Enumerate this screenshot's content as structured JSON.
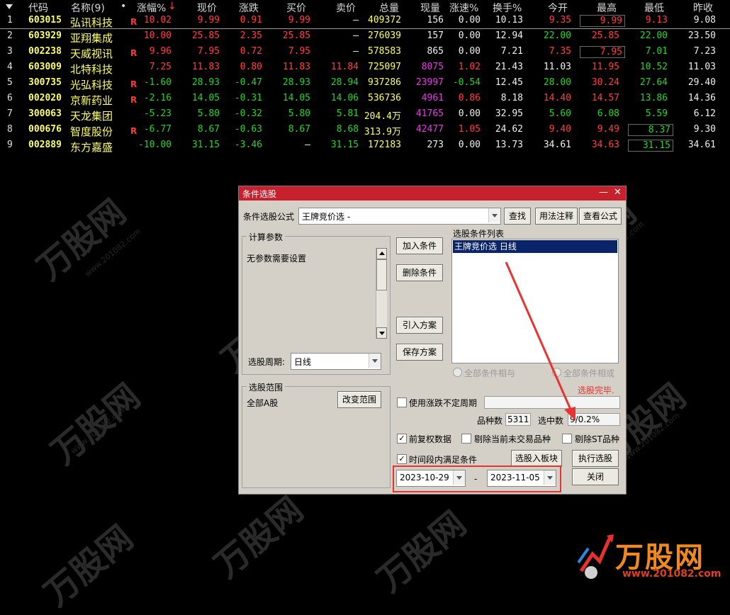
{
  "table": {
    "headers": [
      "代码",
      "名称(9)",
      "•",
      "涨幅%",
      "现价",
      "涨跌",
      "买价",
      "卖价",
      "总量",
      "现量",
      "涨速%",
      "换手%",
      "今开",
      "最高",
      "最低",
      "昨收"
    ],
    "sort_arrow": "↓",
    "rows": [
      {
        "idx": "1",
        "code": "603015",
        "name": "弘讯科技",
        "r": "R",
        "pct": "10.02",
        "price": "9.99",
        "chg": "0.91",
        "bid": "9.99",
        "ask": "–",
        "vol": "409372",
        "cur": "156",
        "speed": "0.00",
        "turn": "10.13",
        "open": "9.35",
        "high": "9.99",
        "low": "9.13",
        "prev": "9.08"
      },
      {
        "idx": "2",
        "code": "603929",
        "name": "亚翔集成",
        "r": "",
        "pct": "10.00",
        "price": "25.85",
        "chg": "2.35",
        "bid": "25.85",
        "ask": "–",
        "vol": "276039",
        "cur": "157",
        "speed": "0.00",
        "turn": "12.94",
        "open": "22.00",
        "high": "25.85",
        "low": "22.00",
        "prev": "23.50"
      },
      {
        "idx": "3",
        "code": "002238",
        "name": "天威视讯",
        "r": "R",
        "pct": "9.96",
        "price": "7.95",
        "chg": "0.72",
        "bid": "7.95",
        "ask": "–",
        "vol": "578583",
        "cur": "865",
        "speed": "0.00",
        "turn": "7.21",
        "open": "7.35",
        "high": "7.95",
        "low": "7.01",
        "prev": "7.23"
      },
      {
        "idx": "4",
        "code": "603009",
        "name": "北特科技",
        "r": "",
        "pct": "7.25",
        "price": "11.83",
        "chg": "0.80",
        "bid": "11.83",
        "ask": "11.84",
        "vol": "725097",
        "cur": "8075",
        "speed": "1.02",
        "turn": "21.43",
        "open": "11.03",
        "high": "11.95",
        "low": "10.52",
        "prev": "11.03"
      },
      {
        "idx": "5",
        "code": "300735",
        "name": "光弘科技",
        "r": "R",
        "pct": "-1.60",
        "price": "28.93",
        "chg": "-0.47",
        "bid": "28.93",
        "ask": "28.94",
        "vol": "937286",
        "cur": "23997",
        "speed": "-0.54",
        "turn": "12.45",
        "open": "28.00",
        "high": "30.24",
        "low": "27.64",
        "prev": "29.40"
      },
      {
        "idx": "6",
        "code": "002020",
        "name": "京新药业",
        "r": "R",
        "pct": "-2.16",
        "price": "14.05",
        "chg": "-0.31",
        "bid": "14.05",
        "ask": "14.06",
        "vol": "536736",
        "cur": "4961",
        "speed": "0.86",
        "turn": "8.18",
        "open": "14.40",
        "high": "14.57",
        "low": "13.86",
        "prev": "14.36"
      },
      {
        "idx": "7",
        "code": "300063",
        "name": "天龙集团",
        "r": "",
        "pct": "-5.23",
        "price": "5.80",
        "chg": "-0.32",
        "bid": "5.80",
        "ask": "5.81",
        "vol": "204.4万",
        "cur": "41765",
        "speed": "0.00",
        "turn": "32.95",
        "open": "5.60",
        "high": "6.08",
        "low": "5.59",
        "prev": "6.12"
      },
      {
        "idx": "8",
        "code": "000676",
        "name": "智度股份",
        "r": "R",
        "pct": "-6.77",
        "price": "8.67",
        "chg": "-0.63",
        "bid": "8.67",
        "ask": "8.68",
        "vol": "313.9万",
        "cur": "42477",
        "speed": "1.05",
        "turn": "24.62",
        "open": "9.40",
        "high": "9.49",
        "low": "8.37",
        "prev": "9.30"
      },
      {
        "idx": "9",
        "code": "002889",
        "name": "东方嘉盛",
        "r": "",
        "pct": "-10.00",
        "price": "31.15",
        "chg": "-3.46",
        "bid": "–",
        "ask": "31.15",
        "vol": "172183",
        "cur": "273",
        "speed": "0.00",
        "turn": "13.73",
        "open": "34.61",
        "high": "34.63",
        "low": "31.15",
        "prev": "34.61"
      }
    ]
  },
  "dialog": {
    "title": "条件选股",
    "min_btn": "—",
    "close_btn": "✕",
    "formula_label": "条件选股公式",
    "formula_value": "王牌竞价选  -",
    "find_btn": "查找",
    "usage_btn": "用法注释",
    "view_btn": "查看公式",
    "params_group": "计算参数",
    "params_text": "无参数需要设置",
    "period_label": "选股周期:",
    "period_value": "日线",
    "scope_group": "选股范围",
    "scope_value": "全部A股",
    "change_scope_btn": "改变范围",
    "add_btn": "加入条件",
    "del_btn": "删除条件",
    "import_btn": "引入方案",
    "save_btn": "保存方案",
    "cond_list_label": "选股条件列表",
    "cond_items": [
      "王牌竞价选  日线"
    ],
    "radio_and": "全部条件相与",
    "radio_or": "全部条件相或",
    "status": "选股完毕.",
    "use_period": "使用涨跌不定周期",
    "count_label": "品种数",
    "count_value": "5311",
    "selected_label": "选中数",
    "selected_value": "9/0.2%",
    "adj_label": "前复权数据",
    "excl_untraded": "剔除当前未交易品种",
    "excl_st": "剔除ST品种",
    "time_cond": "时间段内满足条件",
    "to_block_btn": "选股入板块",
    "exec_btn": "执行选股",
    "close_dlg_btn": "关闭",
    "date_from": "2023-10-29",
    "date_sep": "-",
    "date_to": "2023-11-05"
  },
  "watermark": {
    "brand": "万股网",
    "site": "www.201082.com"
  },
  "logo": {
    "brand": "万股网",
    "site": "www.201082.com"
  }
}
